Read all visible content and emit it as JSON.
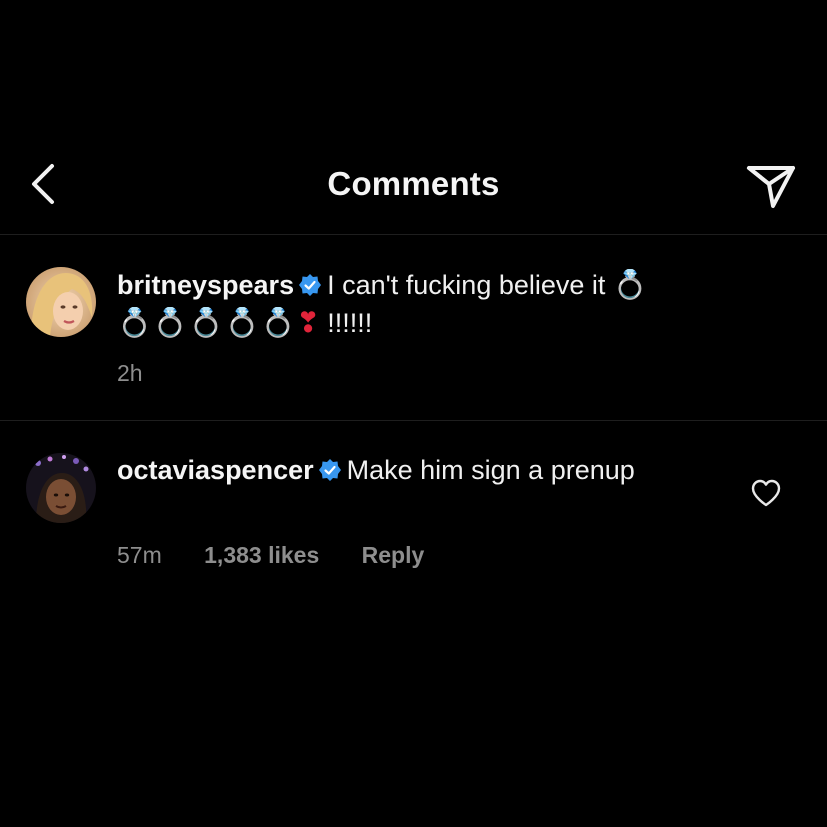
{
  "header": {
    "title": "Comments",
    "back_icon": "chevron-left-icon",
    "share_icon": "paper-plane-icon"
  },
  "caption": {
    "username": "britneyspears",
    "verified": true,
    "text_line1": "I can't fucking believe it",
    "ring_emoji": "💍",
    "rings_line2": "💍💍💍💍💍",
    "heart_emoji": "❣",
    "exclaim": " !!!!!!",
    "time": "2h"
  },
  "comments": [
    {
      "username": "octaviaspencer",
      "verified": true,
      "text": "Make him sign a prenup",
      "time": "57m",
      "likes": "1,383 likes",
      "reply_label": "Reply",
      "like_icon": "heart-outline-icon"
    }
  ],
  "colors": {
    "background": "#000000",
    "text": "#f0f0f0",
    "meta": "#8e8e8e",
    "verified": "#3897f0",
    "divider": "#1e1e1e"
  }
}
